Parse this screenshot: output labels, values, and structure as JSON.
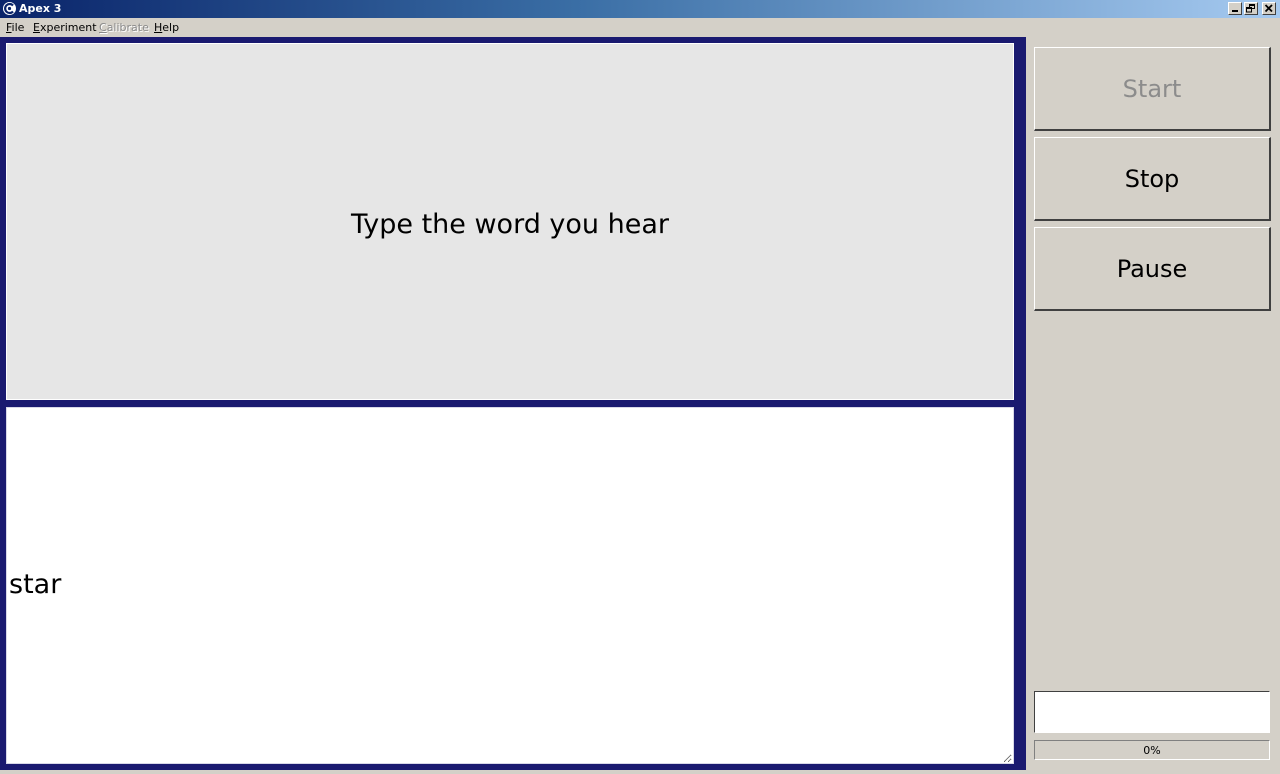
{
  "window": {
    "title": "Apex 3",
    "icon": "apex-logo-icon",
    "controls": [
      "minimize-icon",
      "restore-icon",
      "close-icon"
    ]
  },
  "menu": {
    "items": [
      {
        "label": "File",
        "accel": "F",
        "rest": "ile",
        "enabled": true
      },
      {
        "label": "Experiment",
        "accel": "E",
        "rest": "xperiment",
        "enabled": true
      },
      {
        "label": "Calibrate",
        "accel": "C",
        "rest": "alibrate",
        "enabled": false
      },
      {
        "label": "Help",
        "accel": "H",
        "rest": "elp",
        "enabled": true
      }
    ]
  },
  "prompt": {
    "text": "Type the word you hear"
  },
  "answer": {
    "value": "star"
  },
  "controls": {
    "start_label": "Start",
    "stop_label": "Stop",
    "pause_label": "Pause"
  },
  "status": {
    "value": ""
  },
  "progress": {
    "label": "0%",
    "fraction": 0
  },
  "colors": {
    "frame": "#1a1a70",
    "prompt_bg": "#e6e6e6",
    "answer_bg": "#ffffff",
    "window_bg": "#d4d0c8"
  }
}
